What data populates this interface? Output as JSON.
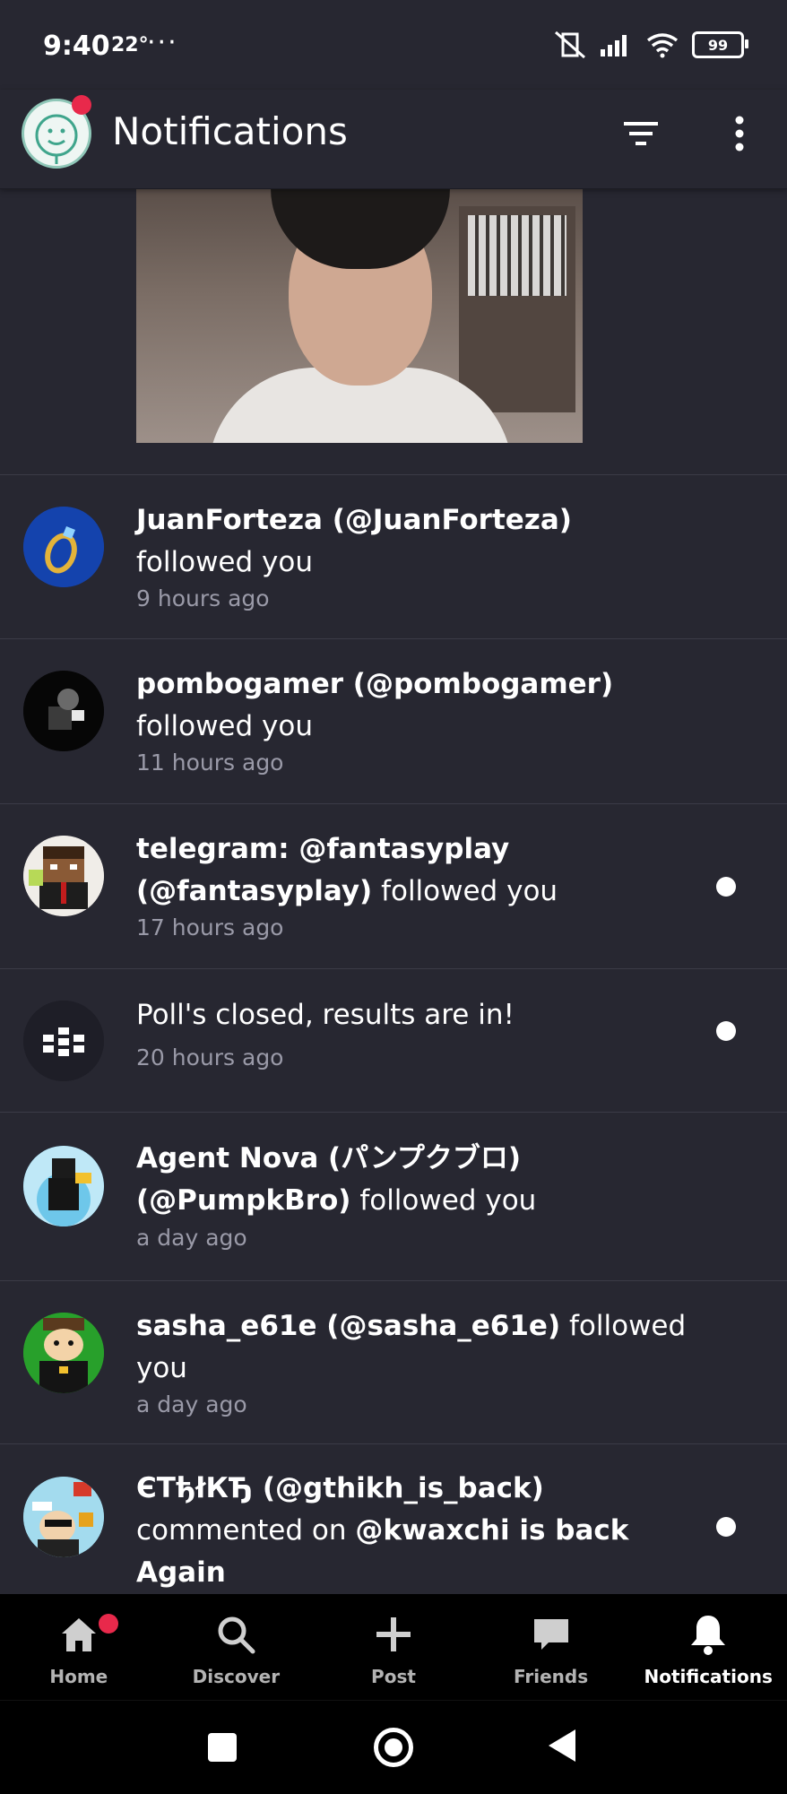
{
  "status_bar": {
    "time": "9:40",
    "temp": "22°",
    "dots": "···",
    "battery": "99"
  },
  "header": {
    "title": "Notifications"
  },
  "notifications": [
    {
      "user": "JuanForteza (@JuanForteza)",
      "action": "followed you",
      "time": "9 hours ago",
      "unread": false
    },
    {
      "user": "pombogamer (@pombogamer)",
      "action": "followed you",
      "time": "11 hours ago",
      "unread": false
    },
    {
      "user": "telegram: @fantasyplay (@fantasyplay)",
      "action": "followed you",
      "time": "17 hours ago",
      "unread": true
    },
    {
      "user": "",
      "action": "Poll's closed, results are in!",
      "time": "20 hours ago",
      "unread": true
    },
    {
      "user": "Agent Nova (パンプクブロ) (@PumpkBro)",
      "action": "followed you",
      "time": "a day ago",
      "unread": false
    },
    {
      "user": "sasha_e61e (@sasha_e61e)",
      "action": "followed you",
      "time": "a day ago",
      "unread": false
    },
    {
      "user": "ЄТђłКЂ (@gthikh_is_back)",
      "action": "commented on",
      "target": "@kwaxchi is back Again",
      "unread": true
    }
  ],
  "bottom_nav": {
    "home": "Home",
    "discover": "Discover",
    "post": "Post",
    "friends": "Friends",
    "notifications": "Notifications"
  },
  "colors": {
    "background": "#272731",
    "separator": "#3b3b47",
    "badge": "#e8294b",
    "nav_bg": "#000000"
  }
}
